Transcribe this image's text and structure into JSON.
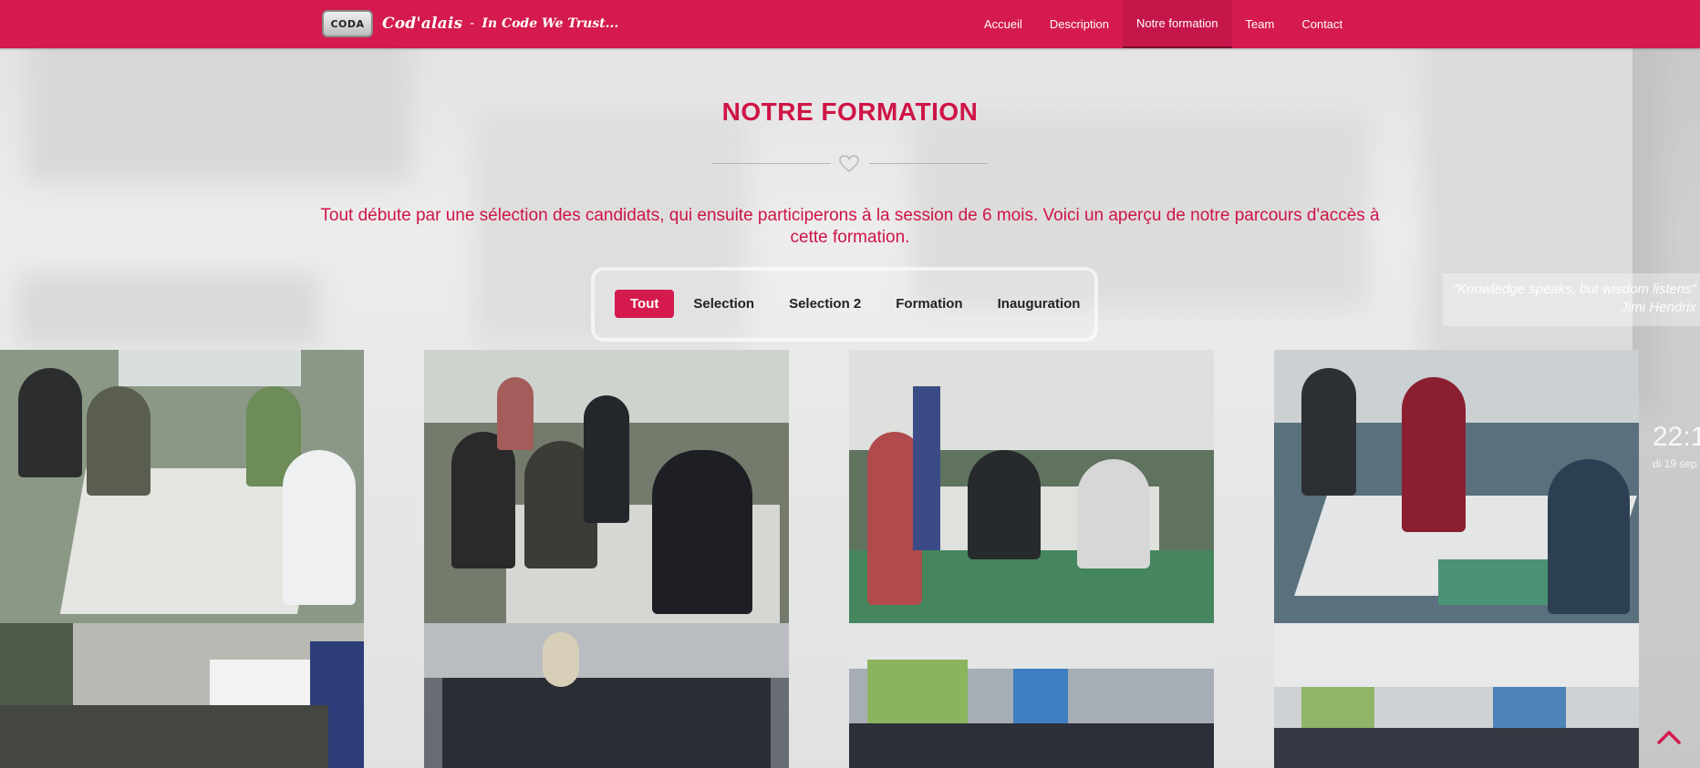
{
  "brand": {
    "logo_text": "CODA",
    "name": "Cod'alais",
    "separator": "-",
    "tagline": "In Code We Trust..."
  },
  "nav": {
    "items": [
      {
        "label": "Accueil"
      },
      {
        "label": "Description"
      },
      {
        "label": "Notre formation"
      },
      {
        "label": "Team"
      },
      {
        "label": "Contact"
      }
    ],
    "active": "Notre formation"
  },
  "section": {
    "title": "NOTRE FORMATION",
    "divider_icon": "heart-icon",
    "intro": "Tout débute par une sélection des candidats, qui ensuite participerons à la session de 6 mois. Voici un aperçu de notre parcours d'accès à cette formation."
  },
  "filters": {
    "items": [
      {
        "label": "Tout"
      },
      {
        "label": "Selection"
      },
      {
        "label": "Selection 2"
      },
      {
        "label": "Formation"
      },
      {
        "label": "Inauguration"
      }
    ],
    "active": "Tout"
  },
  "background_widgets": {
    "quote": "\"Knowledge speaks, but wisdom listens\"",
    "quote_author": "Jimi Hendrix",
    "clock": "22:1",
    "clock_sub": "di 19 sep"
  },
  "gallery": {
    "photos": [
      {
        "name": "photo-selection-1",
        "tone": "#7a8a78"
      },
      {
        "name": "photo-selection-2",
        "tone": "#6b6f63"
      },
      {
        "name": "photo-selection-3",
        "tone": "#5c6e5c"
      },
      {
        "name": "photo-selection-4",
        "tone": "#4f6877"
      },
      {
        "name": "photo-formation-1",
        "tone": "#8a8c86"
      },
      {
        "name": "photo-inauguration-1",
        "tone": "#6c6f78"
      },
      {
        "name": "photo-inauguration-2",
        "tone": "#8e959d"
      },
      {
        "name": "photo-inauguration-3",
        "tone": "#9aa0a6"
      }
    ]
  },
  "colors": {
    "primary": "#d41a4e",
    "title": "#cf1446"
  },
  "scroll_top_icon": "chevron-up-icon"
}
